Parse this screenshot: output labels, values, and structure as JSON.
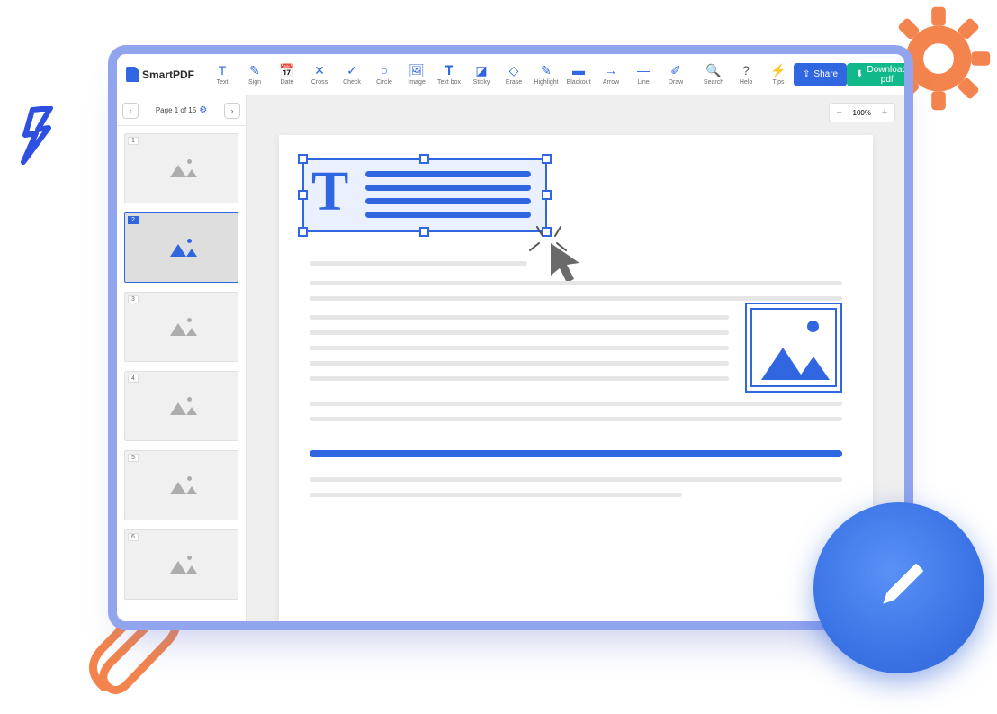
{
  "brand": {
    "name": "SmartPDF"
  },
  "tools": [
    {
      "id": "text",
      "label": "Text",
      "icon": "T"
    },
    {
      "id": "sign",
      "label": "Sign",
      "icon": "✎"
    },
    {
      "id": "date",
      "label": "Date",
      "icon": "📅"
    },
    {
      "id": "cross",
      "label": "Cross",
      "icon": "✕"
    },
    {
      "id": "check",
      "label": "Check",
      "icon": "✓"
    },
    {
      "id": "circle",
      "label": "Circle",
      "icon": "○"
    },
    {
      "id": "image",
      "label": "Image",
      "icon": "🖼"
    },
    {
      "id": "textbox",
      "label": "Text box",
      "icon": "𝐓"
    },
    {
      "id": "sticky",
      "label": "Sticky",
      "icon": "◪"
    },
    {
      "id": "erase",
      "label": "Erase",
      "icon": "◇"
    },
    {
      "id": "highlight",
      "label": "Highlight",
      "icon": "✎"
    },
    {
      "id": "blackout",
      "label": "Blackout",
      "icon": "▬"
    },
    {
      "id": "arrow",
      "label": "Arrow",
      "icon": "→"
    },
    {
      "id": "line",
      "label": "Line",
      "icon": "—"
    },
    {
      "id": "draw",
      "label": "Draw",
      "icon": "✐"
    }
  ],
  "utils": [
    {
      "id": "search",
      "label": "Search",
      "icon": "🔍"
    },
    {
      "id": "help",
      "label": "Help",
      "icon": "?"
    },
    {
      "id": "tips",
      "label": "Tips",
      "icon": "⚡"
    }
  ],
  "buttons": {
    "share": "Share",
    "download": "Download pdf"
  },
  "pager": {
    "label": "Page 1 of 15",
    "prev": "‹",
    "next": "›"
  },
  "zoom": {
    "value": "100%",
    "minus": "−",
    "plus": "+"
  },
  "thumbs": [
    {
      "page": "1",
      "active": false
    },
    {
      "page": "2",
      "active": true
    },
    {
      "page": "3",
      "active": false
    },
    {
      "page": "4",
      "active": false
    },
    {
      "page": "5",
      "active": false
    },
    {
      "page": "6",
      "active": false
    }
  ]
}
